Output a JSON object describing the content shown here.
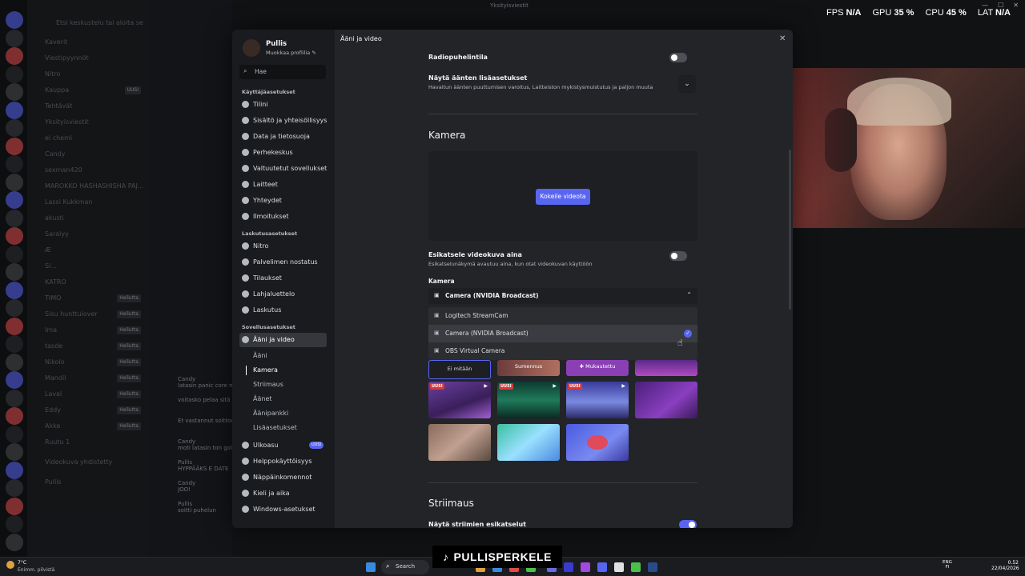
{
  "window_title": "Yksityisviestit",
  "overlay": {
    "fps_label": "FPS",
    "fps_val": "N/A",
    "gpu_label": "GPU",
    "gpu_val": "35 %",
    "cpu_label": "CPU",
    "cpu_val": "45 %",
    "lat_label": "LAT",
    "lat_val": "N/A"
  },
  "bg_channels": {
    "search": "Etsi keskustelu tai aloita se",
    "items": [
      {
        "label": "Kaverit",
        "tag": ""
      },
      {
        "label": "Viestipyynnöt",
        "tag": ""
      },
      {
        "label": "Nitro",
        "tag": ""
      },
      {
        "label": "Kauppa",
        "tag": "UUSI"
      },
      {
        "label": "Tehtävät",
        "tag": ""
      },
      {
        "label": "Yksityisviestit",
        "tag": ""
      },
      {
        "label": "el chemi",
        "tag": ""
      },
      {
        "label": "Candy",
        "tag": ""
      },
      {
        "label": "sexman420",
        "tag": ""
      },
      {
        "label": "MAROKKO HASHASHISHA PAJ...",
        "tag": ""
      },
      {
        "label": "Lassi Kukkman",
        "tag": ""
      },
      {
        "label": "akusti",
        "tag": ""
      },
      {
        "label": "Saralyy",
        "tag": ""
      },
      {
        "label": "Æ",
        "tag": ""
      },
      {
        "label": "Si...",
        "tag": ""
      },
      {
        "label": "KATRO",
        "tag": ""
      },
      {
        "label": "TIMO",
        "tag": "Hellutta"
      },
      {
        "label": "Sisu hunttulover",
        "tag": "Hellutta"
      },
      {
        "label": "Ima",
        "tag": "Hellutta"
      },
      {
        "label": "tasde",
        "tag": "Hellutta"
      },
      {
        "label": "Nikolo",
        "tag": "Hellutta"
      },
      {
        "label": "Mandil",
        "tag": "Hellutta"
      },
      {
        "label": "Laval",
        "tag": "Hellutta"
      },
      {
        "label": "Eddy",
        "tag": "Hellutta"
      },
      {
        "label": "Akke",
        "tag": "Hellutta"
      },
      {
        "label": "Ruutu 1",
        "tag": ""
      },
      {
        "label": "Videokuva yhdistetty",
        "tag": ""
      },
      {
        "label": "Pullis",
        "tag": ""
      }
    ]
  },
  "modal": {
    "profile": {
      "name": "Pullis",
      "edit": "Muokkaa profiilia ✎"
    },
    "search_placeholder": "Hae",
    "sections": [
      {
        "head": "Käyttäjäasetukset",
        "items": [
          "Tilini",
          "Sisältö ja yhteisöllisyys",
          "Data ja tietosuoja",
          "Perhekeskus",
          "Valtuutetut sovellukset",
          "Laitteet",
          "Yhteydet",
          "Ilmoitukset"
        ]
      },
      {
        "head": "Laskutusasetukset",
        "items": [
          "Nitro",
          "Palvelimen nostatus",
          "Tilaukset",
          "Lahjaluettelo",
          "Laskutus"
        ]
      },
      {
        "head": "Sovellusasetukset",
        "items": [
          "Ääni ja video"
        ]
      }
    ],
    "subitems": [
      "Ääni",
      "Kamera",
      "Striimaus",
      "Äänet",
      "Äänipankki",
      "Lisäasetukset"
    ],
    "after_items": [
      {
        "label": "Ulkoasu",
        "badge": "UUSI"
      },
      {
        "label": "Helppokäyttöisyys",
        "badge": ""
      },
      {
        "label": "Näppäinkomennot",
        "badge": ""
      },
      {
        "label": "Kieli ja aika",
        "badge": ""
      },
      {
        "label": "Windows-asetukset",
        "badge": ""
      }
    ],
    "page_title": "Ääni ja video",
    "radio": {
      "label": "Radiopuhelintila",
      "on": false
    },
    "advanced": {
      "label": "Näytä äänten lisäasetukset",
      "desc": "Havaitun äänten puuttumisen varoitus, Laitteiston mykistysmuistutus ja paljon muuta"
    },
    "camera": {
      "title": "Kamera",
      "test_button": "Kokeile videota",
      "preview_label": "Esikatsele videokuva aina",
      "preview_desc": "Esikatselunäkymä avautuu aina, kun otat videokuvan käyttöön",
      "preview_on": false,
      "select_label": "Kamera",
      "selected": "Camera (NVIDIA Broadcast)",
      "options": [
        "Logitech StreamCam",
        "Camera (NVIDIA Broadcast)",
        "OBS Virtual Camera"
      ]
    },
    "backgrounds": {
      "none": "Ei mitään",
      "blur": "Sumennus",
      "custom": "✚ Mukautettu",
      "new_tag": "UUSI"
    },
    "stream": {
      "title": "Striimaus",
      "preview_label": "Näytä striimien esikatselut",
      "preview_on": true
    }
  },
  "bg_chat": [
    {
      "name": "Candy",
      "text": "latasin panic core nu"
    },
    {
      "name": "",
      "text": "voitasko pelaa sitä"
    },
    {
      "name": "",
      "text": "Et vastannut soittoon"
    },
    {
      "name": "Candy",
      "text": "moti latasin ton gol"
    },
    {
      "name": "Pullis",
      "text": "HYPPÄÄKS E DATE"
    },
    {
      "name": "Candy",
      "text": "JOO!"
    },
    {
      "name": "Pullis",
      "text": "soitti puhelun"
    }
  ],
  "taskbar": {
    "weather_temp": "7°C",
    "weather_desc": "Enimm. pilvistä",
    "search": "Search",
    "lang": "ENG",
    "lang2": "FI",
    "time": "0.52",
    "date": "22/04/2026"
  },
  "watermark": "PULLISPERKELE",
  "colors": {
    "accent": "#5865f2",
    "bg": "#111214",
    "modal": "#232428"
  }
}
